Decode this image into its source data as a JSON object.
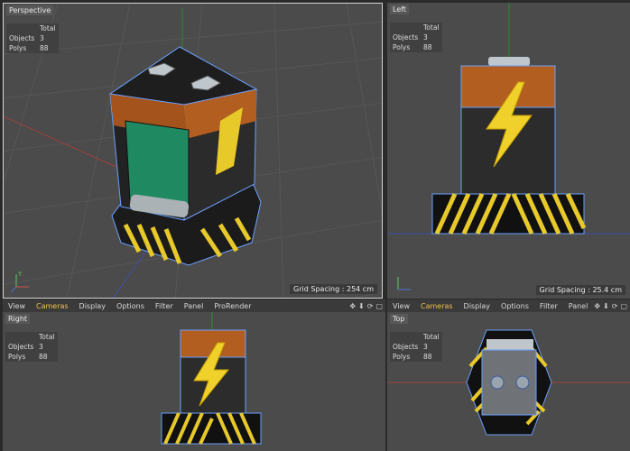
{
  "menu": [
    "View",
    "Cameras",
    "Display",
    "Options",
    "Filter",
    "Panel"
  ],
  "menu_extra": "ProRender",
  "hud": {
    "total": "Total",
    "objects_label": "Objects",
    "objects": "3",
    "polys_label": "Polys",
    "polys": "88"
  },
  "viewports": {
    "perspective": {
      "name": "Perspective",
      "grid": "Grid Spacing : 254 cm"
    },
    "left": {
      "name": "Left",
      "grid": "Grid Spacing : 25.4 cm"
    },
    "right": {
      "name": "Right"
    },
    "top": {
      "name": "Top"
    }
  },
  "axis_labels": {
    "x": "X",
    "y": "Y",
    "z": "Z"
  },
  "icons": [
    "move-icon",
    "down-arrow-icon",
    "rotate-icon",
    "maximize-icon"
  ],
  "colors": {
    "active_menu": "#f2c14a",
    "selection_outline": "#6aa0ff",
    "bg": "#4a4a4a"
  }
}
